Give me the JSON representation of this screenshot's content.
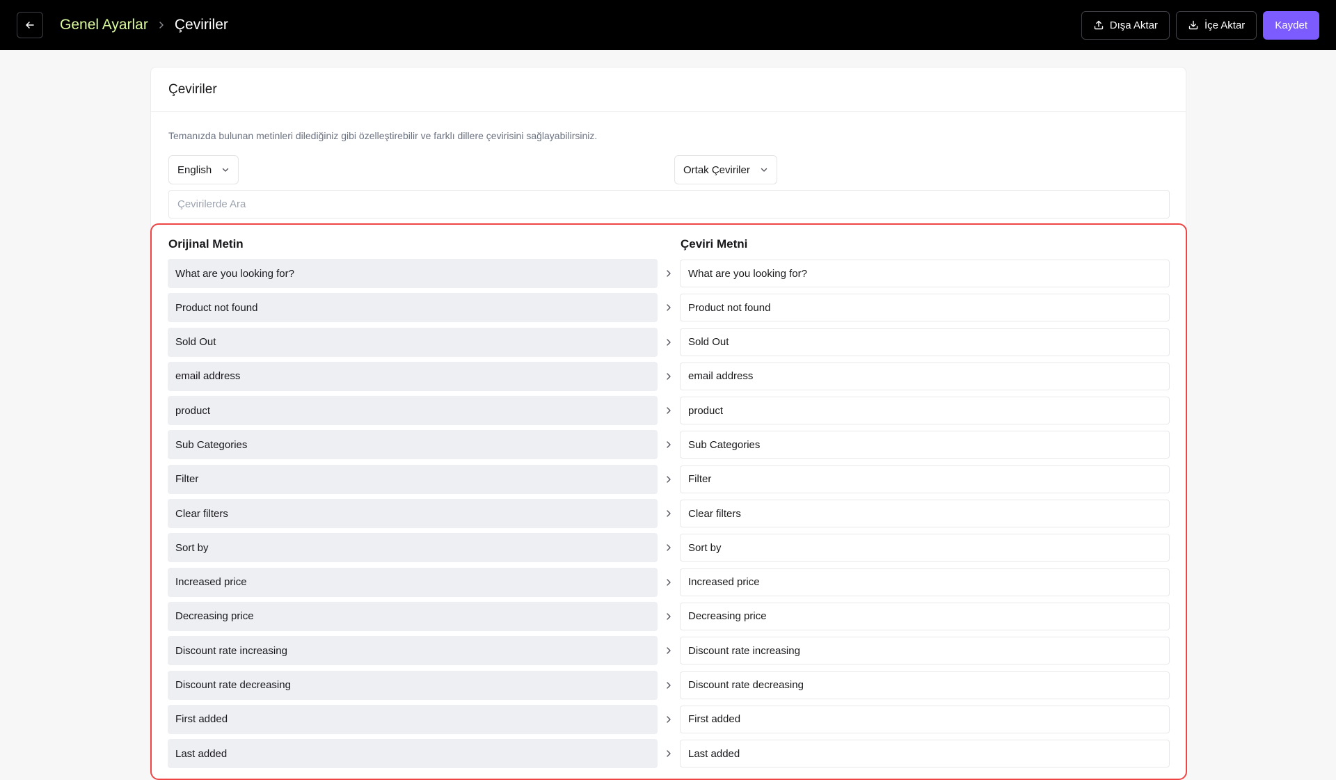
{
  "header": {
    "breadcrumb_root": "Genel Ayarlar",
    "breadcrumb_current": "Çeviriler",
    "export_label": "Dışa Aktar",
    "import_label": "İçe Aktar",
    "save_label": "Kaydet"
  },
  "card": {
    "title": "Çeviriler",
    "description": "Temanızda bulunan metinleri dilediğiniz gibi özelleştirebilir ve farklı dillere çevirisini sağlayabilirsiniz.",
    "language_select": "English",
    "group_select": "Ortak Çeviriler",
    "search_placeholder": "Çevirilerde Ara"
  },
  "translations": {
    "original_header": "Orijinal Metin",
    "translation_header": "Çeviri Metni",
    "rows": [
      {
        "original": "What are you looking for?",
        "translation": "What are you looking for?"
      },
      {
        "original": "Product not found",
        "translation": "Product not found"
      },
      {
        "original": "Sold Out",
        "translation": "Sold Out"
      },
      {
        "original": "email address",
        "translation": "email address"
      },
      {
        "original": "product",
        "translation": "product"
      },
      {
        "original": "Sub Categories",
        "translation": "Sub Categories"
      },
      {
        "original": "Filter",
        "translation": "Filter"
      },
      {
        "original": "Clear filters",
        "translation": "Clear filters"
      },
      {
        "original": "Sort by",
        "translation": "Sort by"
      },
      {
        "original": "Increased price",
        "translation": "Increased price"
      },
      {
        "original": "Decreasing price",
        "translation": "Decreasing price"
      },
      {
        "original": "Discount rate increasing",
        "translation": "Discount rate increasing"
      },
      {
        "original": "Discount rate decreasing",
        "translation": "Discount rate decreasing"
      },
      {
        "original": "First added",
        "translation": "First added"
      },
      {
        "original": "Last added",
        "translation": "Last added"
      }
    ]
  },
  "colors": {
    "topbar_bg": "#000000",
    "breadcrumb_root": "#d9f99d",
    "save_button": "#7c5cff",
    "highlight_border": "#ef4444"
  },
  "icons": {
    "back": "arrow-left-icon",
    "breadcrumb_separator": "chevron-right-icon",
    "export": "upload-icon",
    "import": "download-icon",
    "select": "chevron-down-icon",
    "row_arrow": "chevron-right-icon"
  }
}
